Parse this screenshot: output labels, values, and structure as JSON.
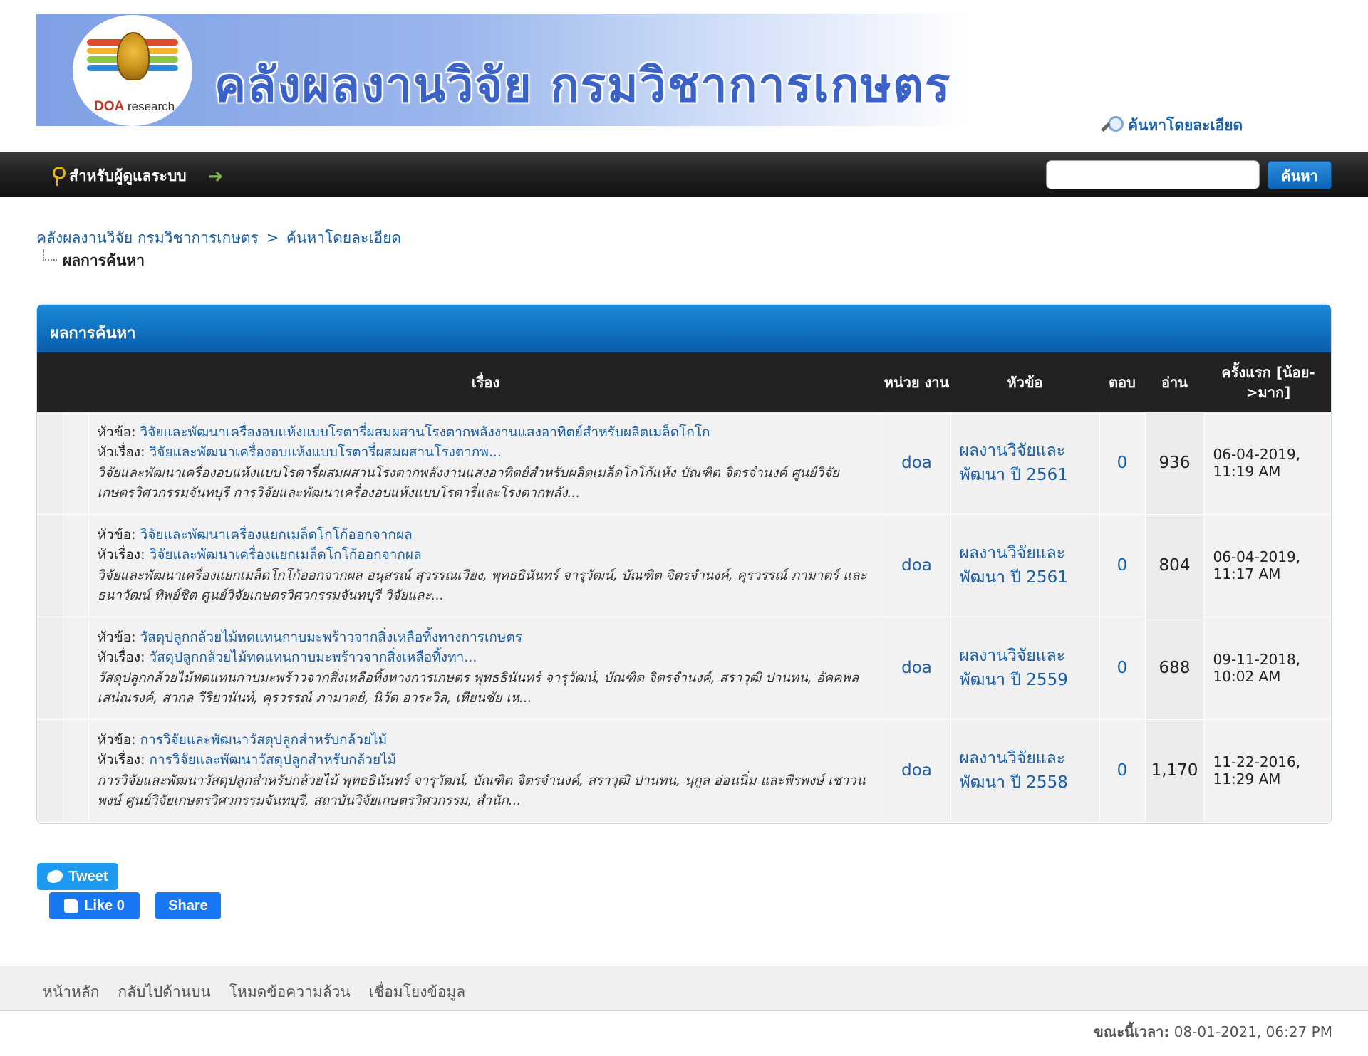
{
  "header": {
    "logo_text_bold": "DOA",
    "logo_text": " research",
    "banner_title": "คลังผลงานวิจัย กรมวิชาการเกษตร",
    "advanced_search": "ค้นหาโดยละเอียด",
    "logo_colors": [
      "#e24b2c",
      "#f2b42a",
      "#8cc63e",
      "#2a88d8"
    ]
  },
  "navbar": {
    "admin_label": "สำหรับผู้ดูแลระบบ",
    "search_placeholder": "",
    "search_button": "ค้นหา"
  },
  "breadcrumb": {
    "items": [
      "คลังผลงานวิจัย กรมวิชาการเกษตร",
      "ค้นหาโดยละเอียด"
    ],
    "separator": ">",
    "current": "ผลการค้นหา"
  },
  "results": {
    "title": "ผลการค้นหา",
    "columns": [
      "เรื่อง",
      "หน่วย งาน",
      "หัวข้อ",
      "ตอบ",
      "อ่าน",
      "ครั้งแรก [น้อย->มาก]"
    ],
    "topic_label": "หัวข้อ:",
    "thread_label": "หัวเรื่อง:",
    "rows": [
      {
        "topic": "วิจัยและพัฒนาเครื่องอบแห้งแบบโรตารี่ผสมผสานโรงตากพลังงานแสงอาทิตย์สำหรับผลิตเมล็ดโกโก",
        "thread": "วิจัยและพัฒนาเครื่องอบแห้งแบบโรตารี่ผสมผสานโรงตากพ...",
        "desc": "วิจัยและพัฒนาเครื่องอบแห้งแบบโรตารี่ผสมผสานโรงตากพลังงานแสงอาทิตย์สำหรับผลิตเมล็ดโกโก้แห้ง บัณฑิต จิตรจำนงค์ ศูนย์วิจัยเกษตรวิศวกรรมจันทบุรี    การวิจัยและพัฒนาเครื่องอบแห้งแบบโรตารี่และโรงตากพลัง...",
        "unit": "doa",
        "forum_line1": "ผลงานวิจัยและ",
        "forum_line2": "พัฒนา ปี 2561",
        "replies": "0",
        "views": "936",
        "date": "06-04-2019, 11:19 AM"
      },
      {
        "topic": "วิจัยและพัฒนาเครื่องแยกเมล็ดโกโก้ออกจากผล",
        "thread": "วิจัยและพัฒนาเครื่องแยกเมล็ดโกโก้ออกจากผล",
        "desc": "วิจัยและพัฒนาเครื่องแยกเมล็ดโกโก้ออกจากผล อนุสรณ์ สุวรรณเวียง, พุทธธินันทร์ จารุวัฒน์, บัณฑิต จิตรจำนงค์, คุรวรรณ์ ภามาตร์ และธนาวัฒน์ ทิพย์ชิต ศูนย์วิจัยเกษตรวิศวกรรมจันทบุรี             วิจัยและ...",
        "unit": "doa",
        "forum_line1": "ผลงานวิจัยและ",
        "forum_line2": "พัฒนา ปี 2561",
        "replies": "0",
        "views": "804",
        "date": "06-04-2019, 11:17 AM"
      },
      {
        "topic": "วัสดุปลูกกล้วยไม้ทดแทนกาบมะพร้าวจากสิ่งเหลือทิ้งทางการเกษตร",
        "thread": "วัสดุปลูกกล้วยไม้ทดแทนกาบมะพร้าวจากสิ่งเหลือทิ้งทา...",
        "desc": "วัสดุปลูกกล้วยไม้ทดแทนกาบมะพร้าวจากสิ่งเหลือทิ้งทางการเกษตร พุทธธินันทร์ จารุวัฒน์, บัณฑิต จิตรจำนงค์, สราวุฒิ ปานทน, อัคคพล เสน่ณรงค์, สากล วีริยานันท์, คุรวรรณ์ ภามาตย์, นิวัต อาระวิล, เทียนชัย เห...",
        "unit": "doa",
        "forum_line1": "ผลงานวิจัยและ",
        "forum_line2": "พัฒนา ปี 2559",
        "replies": "0",
        "views": "688",
        "date": "09-11-2018, 10:02 AM"
      },
      {
        "topic": "การวิจัยและพัฒนาวัสดุปลูกสำหรับกล้วยไม้",
        "thread": "การวิจัยและพัฒนาวัสดุปลูกสำหรับกล้วยไม้",
        "desc": "การวิจัยและพัฒนาวัสดุปลูกสำหรับกล้วยไม้ พุทธธินันทร์ จารุวัฒน์, บัณฑิต จิตรจำนงค์, สราวุฒิ ปานทน, นุกูล อ่อนนิ่ม และพีรพงษ์ เชาวนพงษ์ ศูนย์วิจัยเกษตรวิศวกรรมจันทบุรี, สถาบันวิจัยเกษตรวิศวกรรม, สำนัก...",
        "unit": "doa",
        "forum_line1": "ผลงานวิจัยและ",
        "forum_line2": "พัฒนา ปี 2558",
        "replies": "0",
        "views": "1,170",
        "date": "11-22-2016, 11:29 AM"
      }
    ]
  },
  "social": {
    "tweet": "Tweet",
    "like": "Like 0",
    "share": "Share"
  },
  "footer": {
    "links": [
      "หน้าหลัก",
      "กลับไปด้านบน",
      "โหมดข้อความล้วน",
      "เชื่อมโยงข้อมูล"
    ],
    "time_label": "ขณะนี้เวลา:",
    "time_value": " 08-01-2021, 06:27 PM"
  }
}
